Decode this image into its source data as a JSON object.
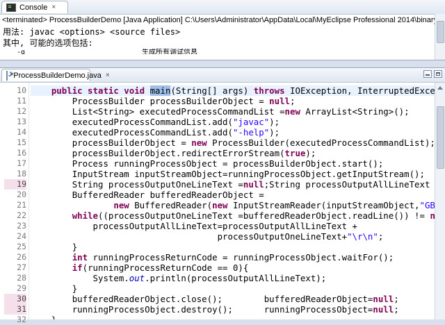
{
  "console": {
    "tab_label": "Console",
    "close_glyph": "×",
    "status": "<terminated> ProcessBuilderDemo [Java Application] C:\\Users\\Administrator\\AppData\\Local\\MyEclipse Professional 2014\\binary\\com.sun.java",
    "lines": [
      "用法: javac <options> <source files>",
      "其中, 可能的选项包括:"
    ],
    "partial_line": {
      "option": "-g",
      "desc": "生成所有调试信息"
    }
  },
  "editor": {
    "tab_label": "*ProcessBuilderDemo.java",
    "close_glyph": "×",
    "line_numbers": [
      "10",
      "11",
      "12",
      "13",
      "14",
      "15",
      "16",
      "17",
      "18",
      "19",
      "20",
      "21",
      "22",
      "23",
      "24",
      "25",
      "26",
      "27",
      "28",
      "29",
      "30",
      "31",
      "32"
    ],
    "breakpoint_lines": [
      "19",
      "30",
      "31"
    ],
    "code": {
      "l10": {
        "indent": "    ",
        "kw1": "public static void ",
        "selected": "main",
        "rest1": "(String[] args) ",
        "kw2": "throws",
        "rest2": " IOException, InterruptedException {"
      },
      "l11": {
        "indent": "        ",
        "a": "ProcessBuilder processBuilderObject = ",
        "kw": "null",
        "b": ";"
      },
      "l12": {
        "indent": "        ",
        "a": "List<String> executedProcessCommandList =",
        "kw": "new",
        "b": " ArrayList<String>();"
      },
      "l13": {
        "indent": "        ",
        "a": "executedProcessCommandList.add(",
        "str": "\"javac\"",
        "b": ");"
      },
      "l14": {
        "indent": "        ",
        "a": "executedProcessCommandList.add(",
        "str": "\"-help\"",
        "b": ");"
      },
      "l15": {
        "indent": "        ",
        "a": "processBuilderObject = ",
        "kw": "new",
        "b": " ProcessBuilder(executedProcessCommandList);"
      },
      "l16": {
        "indent": "        ",
        "a": "processBuilderObject.redirectErrorStream(",
        "kw": "true",
        "b": ");"
      },
      "l17": {
        "indent": "        ",
        "a": "Process runningProcessObject = processBuilderObject.start();"
      },
      "l18": {
        "indent": "        ",
        "a": "InputStream inputStreamObject=runningProcessObject.getInputStream();"
      },
      "l19": {
        "indent": "        ",
        "a": "String processOutputOneLineText =",
        "kw": "null",
        "b": ";String processOutputAllLineText = ",
        "str": "\"\"",
        "c": ";"
      },
      "l20": {
        "indent": "        ",
        "a": "BufferedReader bufferedReaderObject ="
      },
      "l21": {
        "indent": "                ",
        "kw": "new",
        "a": " BufferedReader(",
        "kw2": "new",
        "b": " InputStreamReader(inputStreamObject,",
        "str": "\"GBK\"",
        "c": "));"
      },
      "l22": {
        "indent": "        ",
        "kw": "while",
        "a": "((processOutputOneLineText =bufferedReaderObject.readLine()) != ",
        "kw2": "null",
        "b": " ){"
      },
      "l23": {
        "indent": "            ",
        "a": "processOutputAllLineText=processOutputAllLineText +"
      },
      "l24": {
        "indent": "                                    ",
        "a": "processOutputOneLineText+",
        "str": "\"\\r\\n\"",
        "b": ";"
      },
      "l25": {
        "indent": "        ",
        "a": "}"
      },
      "l26": {
        "indent": "        ",
        "kw": "int",
        "a": " runningProcessReturnCode = runningProcessObject.waitFor();"
      },
      "l27": {
        "indent": "        ",
        "kw": "if",
        "a": "(runningProcessReturnCode == 0){"
      },
      "l28": {
        "indent": "            ",
        "a": "System.",
        "ital": "out",
        "b": ".println(processOutputAllLineText);"
      },
      "l29": {
        "indent": "        ",
        "a": "}"
      },
      "l30": {
        "indent": "        ",
        "a": "bufferedReaderObject.close();        bufferedReaderObject=",
        "kw": "null",
        "b": ";"
      },
      "l31": {
        "indent": "        ",
        "a": "runningProcessObject.destroy();      runningProcessObject=",
        "kw": "null",
        "b": ";"
      },
      "l32": {
        "indent": "    ",
        "a": "}"
      }
    }
  },
  "colors": {
    "keyword": "#7f0055",
    "string": "#2a00ff",
    "selection": "#9ec0ea",
    "breakpoint_line": "#f5dfea",
    "current_line": "#e8f2fe"
  }
}
